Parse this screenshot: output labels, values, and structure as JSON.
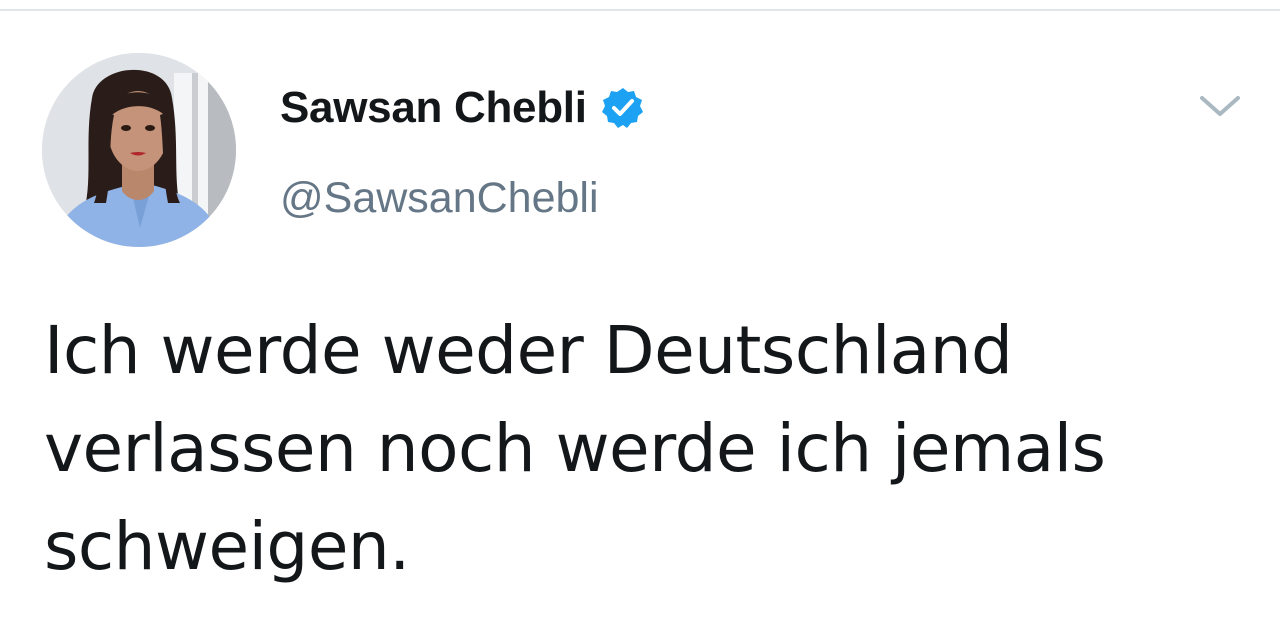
{
  "tweet": {
    "author": {
      "display_name": "Sawsan Chebli",
      "handle": "@SawsanChebli",
      "verified": true,
      "avatar_icon": "profile-photo"
    },
    "menu_icon": "chevron-down-icon",
    "text": "Ich werde weder Deutschland verlassen noch werde ich jemals schweigen."
  },
  "colors": {
    "verified_blue": "#1da1f2",
    "text_primary": "#14171a",
    "text_secondary": "#657786",
    "chevron": "#aab8c2"
  }
}
